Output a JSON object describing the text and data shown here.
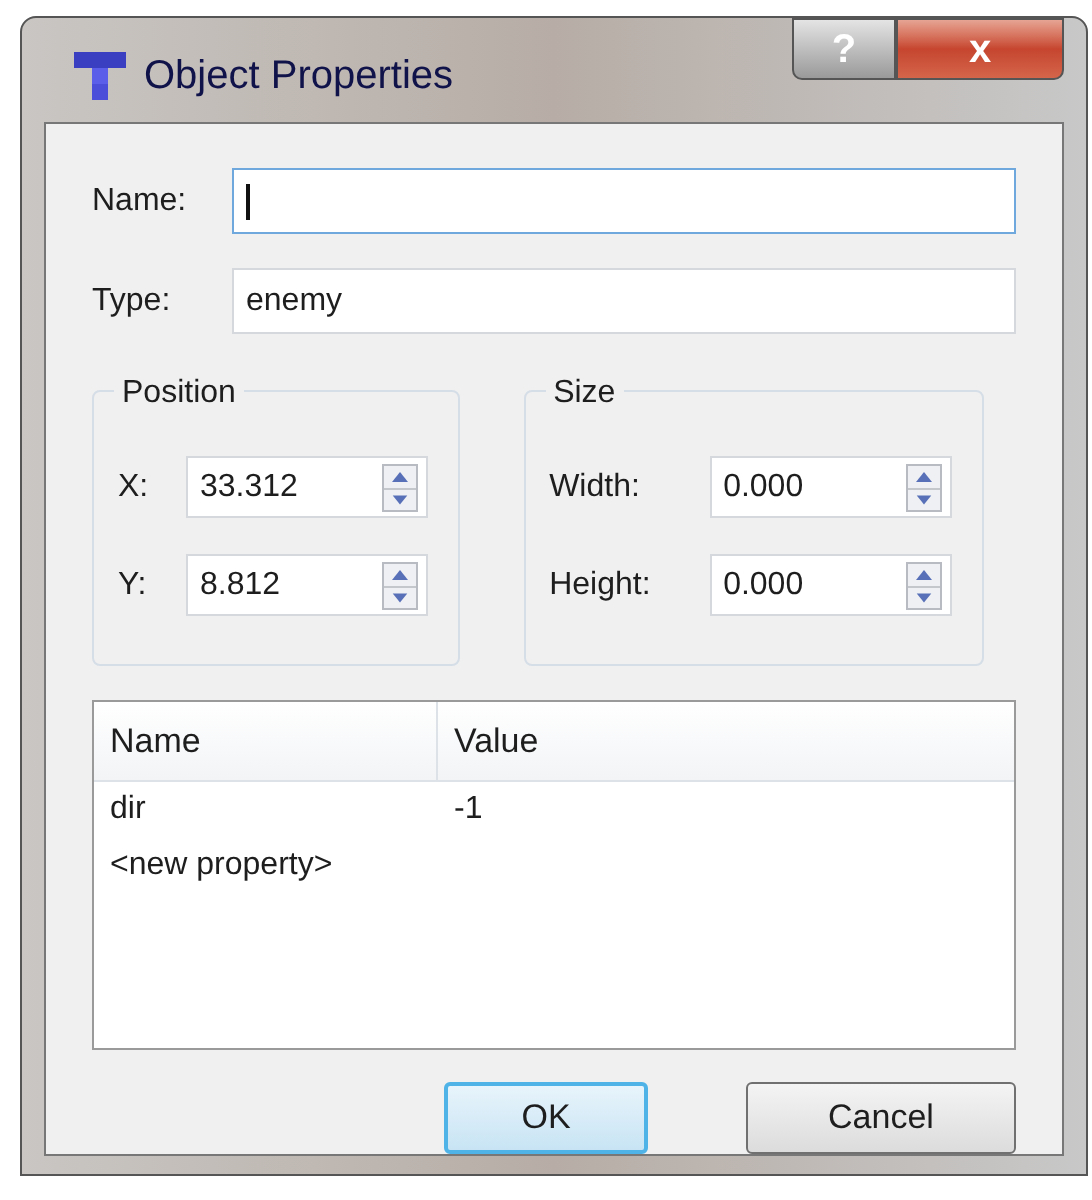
{
  "window": {
    "title": "Object Properties",
    "buttons": [
      {
        "kind": "help",
        "label": "?"
      },
      {
        "kind": "close",
        "label": "x"
      }
    ]
  },
  "name": {
    "label": "Name:",
    "focused": true
  },
  "type": {
    "label": "Type:",
    "value": "enemy"
  },
  "position": {
    "title": "Position",
    "fields": [
      {
        "label": "X:",
        "value": "33.312"
      },
      {
        "label": "Y:",
        "value": "8.812"
      }
    ]
  },
  "size": {
    "title": "Size",
    "fields": [
      {
        "label": "Width:",
        "value": "0.000"
      },
      {
        "label": "Height:",
        "value": "0.000"
      }
    ]
  },
  "table": {
    "columns": [
      "Name",
      "Value"
    ],
    "rows": [
      {
        "name": "dir",
        "value": "-1"
      },
      {
        "name": "<new property>",
        "value": ""
      }
    ]
  },
  "buttons": [
    {
      "label": "OK",
      "default": true
    },
    {
      "label": "Cancel",
      "default": false
    }
  ]
}
